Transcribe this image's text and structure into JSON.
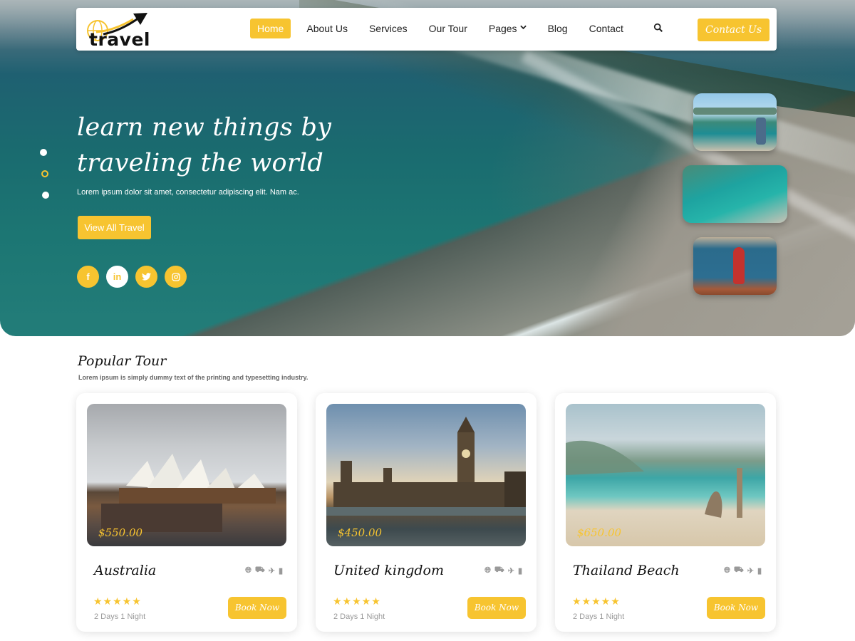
{
  "brand": {
    "logo_text": "travel"
  },
  "nav": {
    "items": [
      {
        "label": "Home",
        "active": true
      },
      {
        "label": "About Us"
      },
      {
        "label": "Services"
      },
      {
        "label": "Our Tour"
      },
      {
        "label": "Pages",
        "has_dropdown": true
      },
      {
        "label": "Blog"
      },
      {
        "label": "Contact"
      }
    ],
    "contact_button": "Contact Us"
  },
  "hero": {
    "title_line1": "learn new things by",
    "title_line2": "traveling the world",
    "subtitle": "Lorem ipsum dolor sit amet, consectetur adipiscing elit. Nam ac.",
    "cta": "View All Travel",
    "socials": [
      {
        "icon": "facebook-icon",
        "glyph": "f"
      },
      {
        "icon": "linkedin-icon",
        "glyph": "in"
      },
      {
        "icon": "twitter-icon",
        "glyph": "🐦"
      },
      {
        "icon": "instagram-icon",
        "glyph": "◎"
      }
    ],
    "slider_dots": 3,
    "active_dot": 2
  },
  "popular": {
    "title": "Popular Tour",
    "subtitle": "Lorem ipsum is simply dummy text of the printing and typesetting industry.",
    "cards": [
      {
        "name": "Australia",
        "price": "$550.00",
        "duration": "2 Days  1 Night",
        "book": "Book Now",
        "rating": 5
      },
      {
        "name": "United kingdom",
        "price": "$450.00",
        "duration": "2 Days  1 Night",
        "book": "Book Now",
        "rating": 5
      },
      {
        "name": "Thailand Beach",
        "price": "$650.00",
        "duration": "2 Days  1 Night",
        "book": "Book Now",
        "rating": 5
      }
    ],
    "card_icons": [
      "globe-icon",
      "car-icon",
      "plane-icon",
      "hotel-icon"
    ]
  },
  "colors": {
    "accent": "#f7c430",
    "text": "#222222",
    "muted": "#999999"
  }
}
